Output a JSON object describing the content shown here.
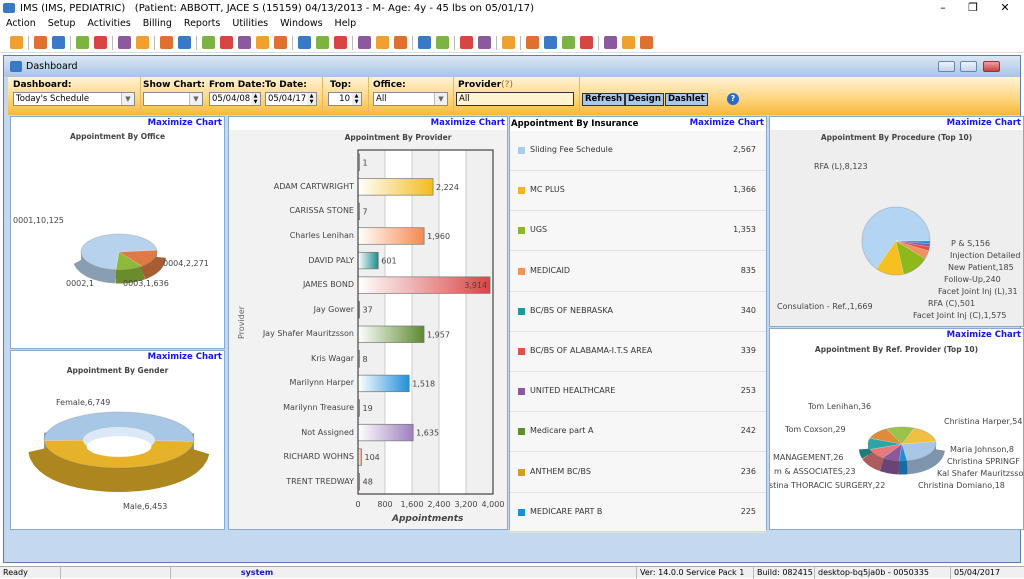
{
  "app": {
    "title": "IMS (IMS, PEDIATRIC)",
    "patient": "(Patient: ABBOTT, JACE S (15159) 04/13/2013 - M- Age: 4y  - 45 lbs on 05/01/17)"
  },
  "window_controls": {
    "minimize": "–",
    "restore": "❐",
    "close": "✕"
  },
  "menu": [
    "Action",
    "Setup",
    "Activities",
    "Billing",
    "Reports",
    "Utilities",
    "Windows",
    "Help"
  ],
  "toolbar": {
    "icons": [
      "user-icon",
      "sep",
      "users-icon",
      "edit-user-icon",
      "sep",
      "folder-icon",
      "notepad-icon",
      "sep",
      "clipboard-icon",
      "flask-icon",
      "sep",
      "document-icon",
      "form-icon",
      "sep",
      "dollar-icon",
      "payment-icon",
      "ledger-icon",
      "billing-icon",
      "claim-icon",
      "sep",
      "calendar-icon",
      "scheduler-icon",
      "letter-icon",
      "sep",
      "send-icon",
      "fax-icon",
      "inbox-icon",
      "sep",
      "report-icon",
      "checklist-icon",
      "sep",
      "chart-icon",
      "folder-user-icon",
      "sep",
      "book-icon",
      "sep",
      "import-icon",
      "export-icon",
      "sync-icon",
      "database-icon",
      "sep",
      "help-icon",
      "lock-icon",
      "logout-icon"
    ],
    "icon_colors": [
      "#f0a030",
      "#e07030",
      "#3a78c8",
      "#7cb342",
      "#d84545",
      "#8b5a9e"
    ]
  },
  "dashboard": {
    "title": "Dashboard",
    "filters": {
      "dashboard_label": "Dashboard:",
      "dashboard_value": "Today's Schedule",
      "show_chart_label": "Show Chart:",
      "show_chart_value": "",
      "from_date_label": "From Date:",
      "from_date_value": "05/04/08",
      "to_date_label": "To Date:",
      "to_date_value": "05/04/17",
      "top_label": "Top:",
      "top_value": "10",
      "office_label": "Office:",
      "office_value": "All",
      "provider_label": "Provider",
      "provider_hint": "(?)",
      "provider_value": "All"
    },
    "buttons": {
      "refresh": "Refresh",
      "design": "Design",
      "dashlet": "Dashlet",
      "help": "?"
    },
    "maximize_chart": "Maximize  Chart"
  },
  "chart_data": [
    {
      "type": "pie",
      "title": "Appointment By Office",
      "labels": [
        "0001,10,125",
        "0002,1",
        "0003,1,636",
        "0004,2,271"
      ],
      "values": [
        10125,
        1,
        1636,
        2271
      ],
      "colors": [
        "#b7d2ec",
        "#e8e8e8",
        "#8dba3a",
        "#e07a45"
      ]
    },
    {
      "type": "pie",
      "title": "Appointment By Gender",
      "donut": true,
      "labels": [
        "Female,6,749",
        "Male,6,453"
      ],
      "values": [
        6749,
        6453
      ],
      "colors": [
        "#a8c6e6",
        "#e6b22a"
      ]
    },
    {
      "type": "bar",
      "orientation": "horizontal",
      "title": "Appointment By Provider",
      "xlabel": "Appointments",
      "ylabel": "Provider",
      "xlim": [
        0,
        4000
      ],
      "xticks": [
        "0",
        "800",
        "1,600",
        "2,400",
        "3,200",
        "4,000"
      ],
      "categories": [
        "",
        "ADAM CARTWRIGHT",
        "CARISSA STONE",
        "Charles Lenihan",
        "DAVID PALY",
        "JAMES BOND",
        "Jay Gower",
        "Jay Shafer Mauritzsson",
        "Kris Wagar",
        "Marilynn Harper",
        "Marilynn Treasure",
        "Not Assigned",
        "RICHARD WOHNS",
        "TRENT TREDWAY"
      ],
      "values": [
        1,
        2224,
        7,
        1960,
        601,
        3914,
        37,
        1957,
        8,
        1518,
        19,
        1635,
        104,
        48
      ],
      "value_labels": [
        "1",
        "2,224",
        "7",
        "1,960",
        "601",
        "3,914",
        "37",
        "1,957",
        "8",
        "1,518",
        "19",
        "1,635",
        "104",
        "48"
      ],
      "colors": [
        "#888",
        "#f3bc1c",
        "#888",
        "#f5894c",
        "#1c8c8c",
        "#d84545",
        "#333",
        "#5c8a2e",
        "#888",
        "#1f8fd8",
        "#888",
        "#9e7fbf",
        "#e09a7a",
        "#b08080"
      ]
    },
    {
      "type": "table",
      "title": "Appointment By Insurance",
      "rows": [
        {
          "name": "Sliding Fee Schedule",
          "value": "2,567",
          "color": "#a6cdea"
        },
        {
          "name": "MC PLUS",
          "value": "1,366",
          "color": "#f1b719"
        },
        {
          "name": "UGS",
          "value": "1,353",
          "color": "#8db825"
        },
        {
          "name": "MEDICAID",
          "value": "835",
          "color": "#f2925f"
        },
        {
          "name": "BC/BS OF NEBRASKA",
          "value": "340",
          "color": "#1f9a99"
        },
        {
          "name": "BC/BS OF ALABAMA-I.T.S AREA",
          "value": "339",
          "color": "#e0504d"
        },
        {
          "name": "UNITED HEALTHCARE",
          "value": "253",
          "color": "#8b5a9e"
        },
        {
          "name": "Medicare part A",
          "value": "242",
          "color": "#5d8e2f"
        },
        {
          "name": "ANTHEM BC/BS",
          "value": "236",
          "color": "#d4a01a"
        },
        {
          "name": "MEDICARE PART B",
          "value": "225",
          "color": "#1e8ed6"
        }
      ]
    },
    {
      "type": "pie",
      "title": "Appointment By Procedure (Top 10)",
      "labels": [
        "RFA (L),8,123",
        "Consulation - Ref.,1,669",
        "Facet Joint Inj (C),1,575",
        "RFA (C),501",
        "Facet Joint Inj (L),31",
        "Follow-Up,240",
        "New Patient,185",
        "Injection Detailed",
        "P & S,156"
      ],
      "values": [
        8123,
        1669,
        1575,
        501,
        null,
        240,
        185,
        null,
        156
      ],
      "colors": [
        "#b3d5f3",
        "#f5c020",
        "#8dba1a",
        "#f2925f",
        "#1f9a99",
        "#e0504d",
        "#8b5a9e",
        "#5d8e2f",
        "#1e8ed6"
      ]
    },
    {
      "type": "pie",
      "title": "Appointment By Ref. Provider (Top 10)",
      "labels": [
        "Christina Harper,54",
        "Maria Johnson,8",
        "Christina SPRINGF",
        "Kal Shafer Mauritzsso",
        "Christina Domiano,18",
        "stina THORACIC SURGERY,22",
        "m & ASSOCIATES,23",
        "MANAGEMENT,26",
        "Tom Coxson,29",
        "Tom Lenihan,36"
      ],
      "values": [
        54,
        8,
        null,
        null,
        18,
        22,
        23,
        26,
        29,
        36
      ],
      "colors": [
        "#a8c6e6",
        "#1e8ed6",
        "#5d8e2f",
        "#1f9a99",
        "#8b5a9e",
        "#e57a7a",
        "#2aa6a6",
        "#e08a3a",
        "#9bc24a",
        "#f0c040"
      ]
    }
  ],
  "status": {
    "ready": "Ready",
    "user": "system",
    "version": "Ver: 14.0.0 Service Pack 1",
    "build": "Build: 082415",
    "machine": "desktop-bq5ja0b - 0050335",
    "date": "05/04/2017"
  }
}
